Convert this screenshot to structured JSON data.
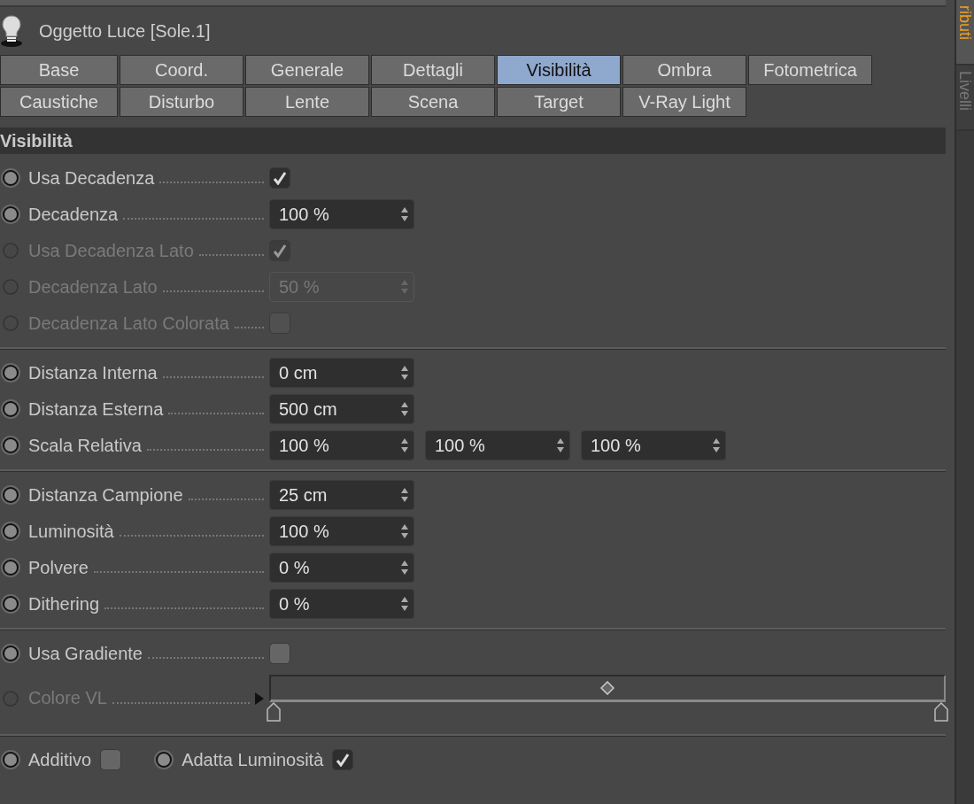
{
  "window": {
    "title": "Oggetto Luce [Sole.1]"
  },
  "tab_rows": [
    [
      {
        "label": "Base",
        "selected": false
      },
      {
        "label": "Coord.",
        "selected": false
      },
      {
        "label": "Generale",
        "selected": false
      },
      {
        "label": "Dettagli",
        "selected": false
      },
      {
        "label": "Visibilità",
        "selected": true
      },
      {
        "label": "Ombra",
        "selected": false
      },
      {
        "label": "Fotometrica",
        "selected": false
      }
    ],
    [
      {
        "label": "Caustiche",
        "selected": false
      },
      {
        "label": "Disturbo",
        "selected": false
      },
      {
        "label": "Lente",
        "selected": false
      },
      {
        "label": "Scena",
        "selected": false
      },
      {
        "label": "Target",
        "selected": false
      },
      {
        "label": "V-Ray Light",
        "selected": false
      }
    ]
  ],
  "section": {
    "title": "Visibilità"
  },
  "groups": [
    {
      "rows": [
        {
          "kind": "checkbox",
          "label": "Usa Decadenza",
          "disabled": false,
          "checked": true
        },
        {
          "kind": "number",
          "label": "Decadenza",
          "disabled": false,
          "values": [
            "100 %"
          ]
        },
        {
          "kind": "checkbox",
          "label": "Usa Decadenza Lato",
          "disabled": true,
          "checked": true
        },
        {
          "kind": "number",
          "label": "Decadenza Lato",
          "disabled": true,
          "values": [
            "50 %"
          ]
        },
        {
          "kind": "checkbox",
          "label": "Decadenza Lato Colorata",
          "disabled": true,
          "checked": false
        }
      ]
    },
    {
      "rows": [
        {
          "kind": "number",
          "label": "Distanza Interna",
          "disabled": false,
          "values": [
            "0 cm"
          ]
        },
        {
          "kind": "number",
          "label": "Distanza Esterna",
          "disabled": false,
          "values": [
            "500 cm"
          ]
        },
        {
          "kind": "number",
          "label": "Scala Relativa",
          "disabled": false,
          "values": [
            "100 %",
            "100 %",
            "100 %"
          ]
        }
      ]
    },
    {
      "rows": [
        {
          "kind": "number",
          "label": "Distanza Campione",
          "disabled": false,
          "values": [
            "25 cm"
          ]
        },
        {
          "kind": "number",
          "label": "Luminosità",
          "disabled": false,
          "values": [
            "100 %"
          ]
        },
        {
          "kind": "number",
          "label": "Polvere",
          "disabled": false,
          "values": [
            "0 %"
          ]
        },
        {
          "kind": "number",
          "label": "Dithering",
          "disabled": false,
          "values": [
            "0 %"
          ]
        }
      ]
    },
    {
      "rows": [
        {
          "kind": "checkbox",
          "label": "Usa Gradiente",
          "disabled": false,
          "checked": false
        },
        {
          "kind": "gradient",
          "label": "Colore VL",
          "disabled": true
        }
      ]
    },
    {
      "rows": [
        {
          "kind": "inline",
          "items": [
            {
              "label": "Additivo",
              "checked": false
            },
            {
              "label": "Adatta Luminosità",
              "checked": true
            }
          ]
        }
      ]
    }
  ],
  "side_tabs": [
    {
      "label": "ributi",
      "selected": true
    },
    {
      "label": "Livelli",
      "selected": false
    }
  ]
}
